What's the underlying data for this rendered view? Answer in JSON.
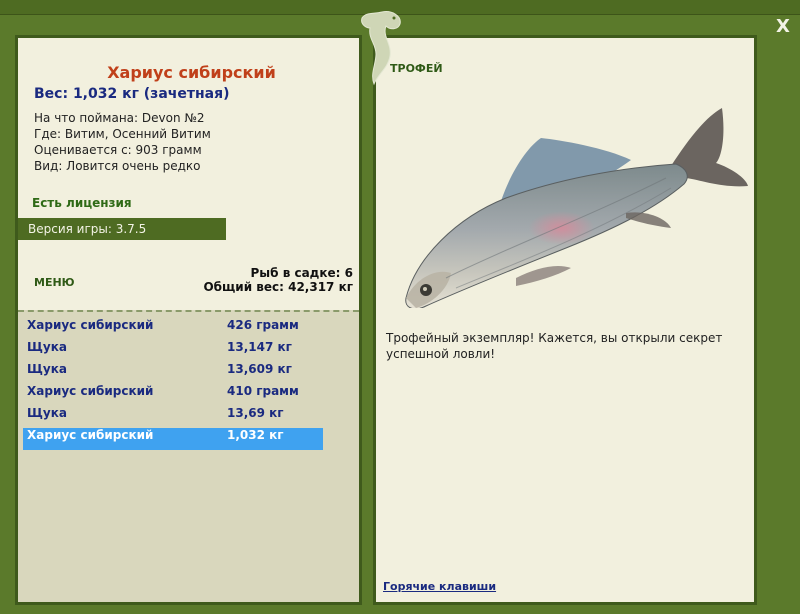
{
  "window": {
    "close_glyph": "X"
  },
  "fish": {
    "title": "Хариус сибирский",
    "weight_line": "Вес: 1,032 кг (зачетная)",
    "bait": "На что поймана: Devon №2",
    "location": "Где: Витим, Осенний Витим",
    "value": "Оценивается с: 903 грамм",
    "rarity": "Вид: Ловится очень редко"
  },
  "license": "Есть лицензия",
  "version": "Версия игры: 3.7.5",
  "menu_label": "МЕНЮ",
  "stats": {
    "fish_in_net": "Рыб в садке: 6",
    "total_weight": "Общий вес: 42,317 кг"
  },
  "catch_list": [
    {
      "name": "Хариус сибирский",
      "weight": "426 грамм"
    },
    {
      "name": "Щука",
      "weight": "13,147 кг"
    },
    {
      "name": "Щука",
      "weight": "13,609 кг"
    },
    {
      "name": "Хариус сибирский",
      "weight": "410 грамм"
    },
    {
      "name": "Щука",
      "weight": "13,69 кг"
    },
    {
      "name": "Хариус сибирский",
      "weight": "1,032 кг",
      "selected": true
    }
  ],
  "trophy": {
    "label": "ТРОФЕЙ",
    "text": "Трофейный экземпляр! Кажется, вы открыли секрет успешной ловли!"
  },
  "hotkeys_label": "Горячие клавиши",
  "colors": {
    "frame": "#5b7a2b",
    "panel": "#f2f0de",
    "selected": "#3fa2f0",
    "title": "#c0401a",
    "link": "#1a2a80"
  }
}
